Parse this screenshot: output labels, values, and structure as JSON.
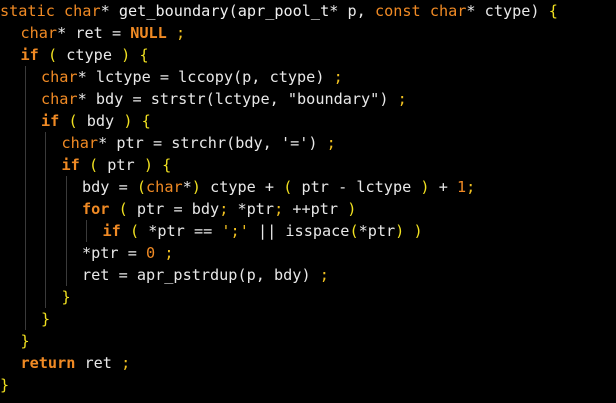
{
  "editor": {
    "background": "#000000",
    "lines": [
      {
        "indent": 0,
        "tokens": [
          {
            "t": "static ",
            "c": "t-kw"
          },
          {
            "t": "char",
            "c": "t-kw"
          },
          {
            "t": "* ",
            "c": "t-op"
          },
          {
            "t": "get_boundary",
            "c": "t-fn"
          },
          {
            "t": "(",
            "c": "t-op"
          },
          {
            "t": "apr_pool_t",
            "c": "t-fn"
          },
          {
            "t": "* p, ",
            "c": "t-op"
          },
          {
            "t": "const ",
            "c": "t-kw"
          },
          {
            "t": "char",
            "c": "t-kw"
          },
          {
            "t": "* ctype) ",
            "c": "t-op"
          },
          {
            "t": "{",
            "c": "t-brace"
          }
        ]
      },
      {
        "indent": 1,
        "tokens": [
          {
            "t": "char",
            "c": "t-kw"
          },
          {
            "t": "* ret = ",
            "c": "t-op"
          },
          {
            "t": "NULL",
            "c": "t-const"
          },
          {
            "t": " ",
            "c": "t-sp"
          },
          {
            "t": ";",
            "c": "t-semi"
          }
        ]
      },
      {
        "indent": 1,
        "tokens": [
          {
            "t": "if",
            "c": "t-ctl"
          },
          {
            "t": " ",
            "c": "t-sp"
          },
          {
            "t": "(",
            "c": "t-par"
          },
          {
            "t": " ctype ",
            "c": "t-id"
          },
          {
            "t": ")",
            "c": "t-par"
          },
          {
            "t": " ",
            "c": "t-sp"
          },
          {
            "t": "{",
            "c": "t-brace"
          }
        ]
      },
      {
        "indent": 2,
        "tokens": [
          {
            "t": "char",
            "c": "t-kw"
          },
          {
            "t": "* lctype = lccopy(p, ctype) ",
            "c": "t-op"
          },
          {
            "t": ";",
            "c": "t-semi"
          }
        ]
      },
      {
        "indent": 2,
        "tokens": [
          {
            "t": "char",
            "c": "t-kw"
          },
          {
            "t": "* bdy = strstr(lctype, \"boundary\") ",
            "c": "t-op"
          },
          {
            "t": ";",
            "c": "t-semi"
          }
        ]
      },
      {
        "indent": 2,
        "tokens": [
          {
            "t": "if",
            "c": "t-ctl"
          },
          {
            "t": " ",
            "c": "t-sp"
          },
          {
            "t": "(",
            "c": "t-par"
          },
          {
            "t": " bdy ",
            "c": "t-id"
          },
          {
            "t": ")",
            "c": "t-par"
          },
          {
            "t": " ",
            "c": "t-sp"
          },
          {
            "t": "{",
            "c": "t-brace"
          }
        ]
      },
      {
        "indent": 3,
        "tokens": [
          {
            "t": "char",
            "c": "t-kw"
          },
          {
            "t": "* ptr = strchr(bdy, '=') ",
            "c": "t-op"
          },
          {
            "t": ";",
            "c": "t-semi"
          }
        ]
      },
      {
        "indent": 3,
        "tokens": [
          {
            "t": "if",
            "c": "t-ctl"
          },
          {
            "t": " ",
            "c": "t-sp"
          },
          {
            "t": "(",
            "c": "t-par"
          },
          {
            "t": " ptr ",
            "c": "t-id"
          },
          {
            "t": ")",
            "c": "t-par"
          },
          {
            "t": " ",
            "c": "t-sp"
          },
          {
            "t": "{",
            "c": "t-brace"
          }
        ]
      },
      {
        "indent": 4,
        "tokens": [
          {
            "t": "bdy = ",
            "c": "t-op"
          },
          {
            "t": "(",
            "c": "t-par"
          },
          {
            "t": "char",
            "c": "t-kw"
          },
          {
            "t": "*",
            "c": "t-op"
          },
          {
            "t": ")",
            "c": "t-par"
          },
          {
            "t": " ctype + ",
            "c": "t-op"
          },
          {
            "t": "(",
            "c": "t-par"
          },
          {
            "t": " ptr - lctype ",
            "c": "t-id"
          },
          {
            "t": ")",
            "c": "t-par"
          },
          {
            "t": " + ",
            "c": "t-op"
          },
          {
            "t": "1",
            "c": "t-num"
          },
          {
            "t": ";",
            "c": "t-semi"
          }
        ]
      },
      {
        "indent": 4,
        "tokens": [
          {
            "t": "for",
            "c": "t-ctl"
          },
          {
            "t": " ",
            "c": "t-sp"
          },
          {
            "t": "(",
            "c": "t-par"
          },
          {
            "t": " ptr = bdy",
            "c": "t-id"
          },
          {
            "t": ";",
            "c": "t-semi"
          },
          {
            "t": " *ptr",
            "c": "t-id"
          },
          {
            "t": ";",
            "c": "t-semi"
          },
          {
            "t": " ++ptr ",
            "c": "t-id"
          },
          {
            "t": ")",
            "c": "t-par"
          }
        ]
      },
      {
        "indent": 5,
        "tokens": [
          {
            "t": "if",
            "c": "t-ctl"
          },
          {
            "t": " ",
            "c": "t-sp"
          },
          {
            "t": "(",
            "c": "t-par"
          },
          {
            "t": " *ptr == ",
            "c": "t-id"
          },
          {
            "t": "';'",
            "c": "t-semi"
          },
          {
            "t": " || isspace",
            "c": "t-id"
          },
          {
            "t": "(",
            "c": "t-par"
          },
          {
            "t": "*ptr",
            "c": "t-id"
          },
          {
            "t": ")",
            "c": "t-par"
          },
          {
            "t": " ",
            "c": "t-sp"
          },
          {
            "t": ")",
            "c": "t-par"
          }
        ]
      },
      {
        "indent": 4,
        "tokens": [
          {
            "t": "*ptr = ",
            "c": "t-op"
          },
          {
            "t": "0",
            "c": "t-num"
          },
          {
            "t": " ",
            "c": "t-sp"
          },
          {
            "t": ";",
            "c": "t-semi"
          }
        ]
      },
      {
        "indent": 4,
        "tokens": [
          {
            "t": "ret = apr_pstrdup(p, bdy) ",
            "c": "t-op"
          },
          {
            "t": ";",
            "c": "t-semi"
          }
        ]
      },
      {
        "indent": 3,
        "tokens": [
          {
            "t": "}",
            "c": "t-brace"
          }
        ]
      },
      {
        "indent": 2,
        "tokens": [
          {
            "t": "}",
            "c": "t-brace"
          }
        ]
      },
      {
        "indent": 1,
        "tokens": [
          {
            "t": "}",
            "c": "t-brace"
          }
        ]
      },
      {
        "indent": 1,
        "tokens": [
          {
            "t": "return",
            "c": "t-ctl"
          },
          {
            "t": " ret ",
            "c": "t-id"
          },
          {
            "t": ";",
            "c": "t-semi"
          }
        ]
      },
      {
        "indent": 0,
        "tokens": [
          {
            "t": "}",
            "c": "t-brace"
          }
        ]
      }
    ]
  }
}
